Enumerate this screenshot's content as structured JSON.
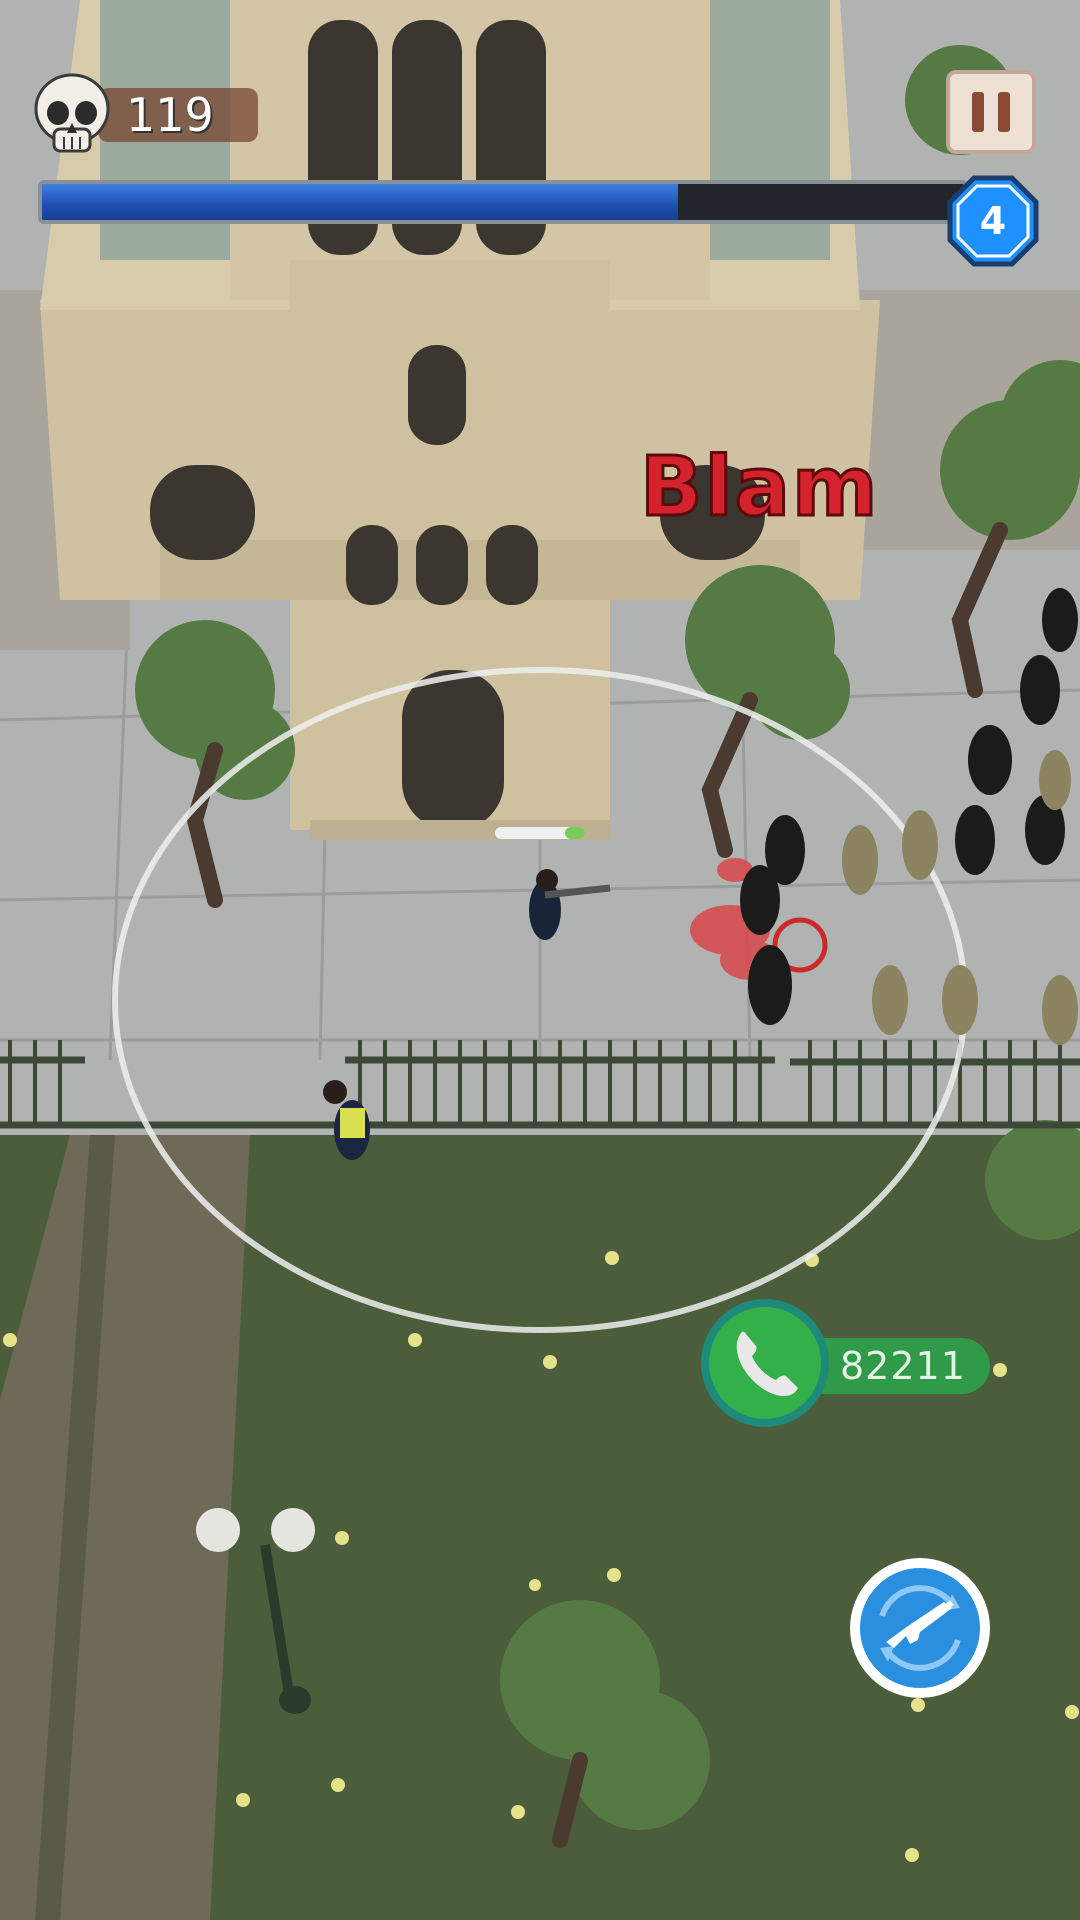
{
  "hud": {
    "kill_count": "119",
    "level": "4",
    "level_progress": 0.69
  },
  "combat_text": "Blam",
  "call_widget": {
    "amount": "82211"
  },
  "icons": {
    "kills": "skull-icon",
    "pause": "pause-icon",
    "call": "phone-icon",
    "weapon_swap": "rifle-swap-icon"
  },
  "colors": {
    "progress_fill": "#2f63c8",
    "level_badge": "#1e90ff",
    "blam_text": "#d4232c",
    "call_green": "#2f9a4a",
    "weapon_button": "#2a8fdf"
  }
}
